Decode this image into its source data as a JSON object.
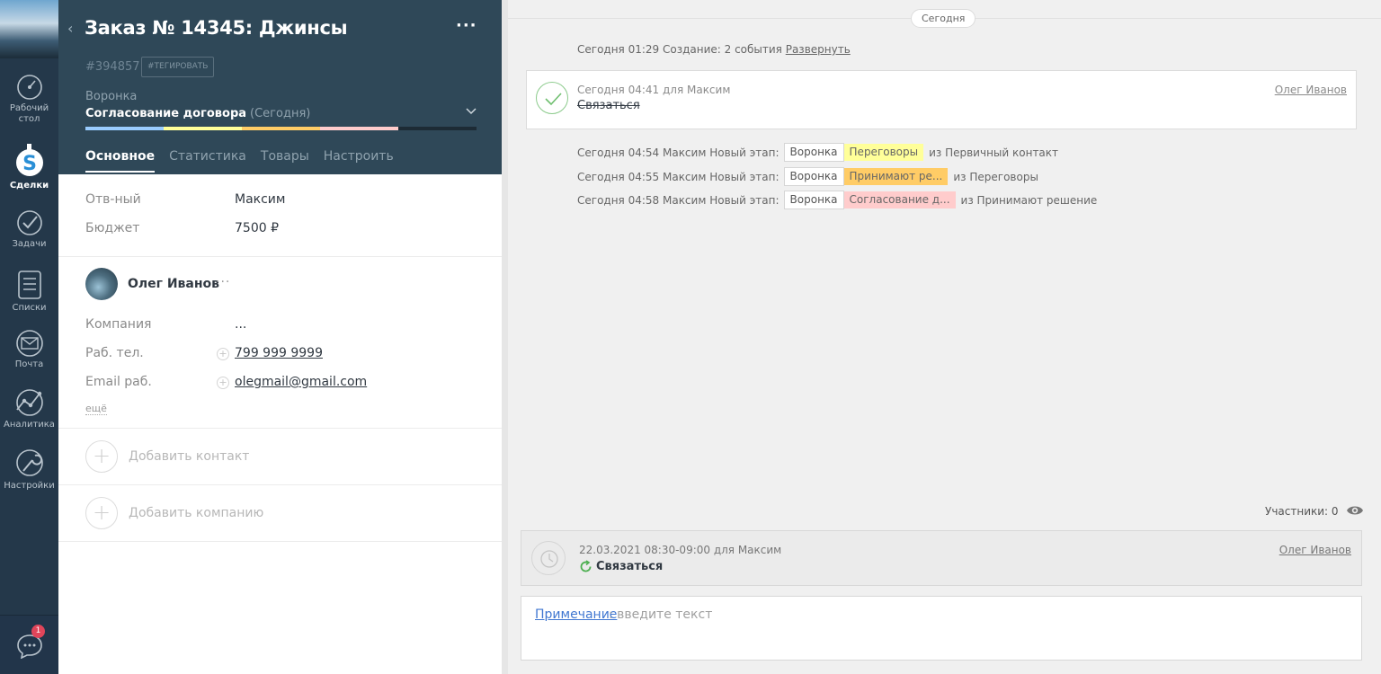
{
  "nav": {
    "items": [
      {
        "label1": "Рабочий",
        "label2": "стол"
      },
      {
        "label1": "Сделки",
        "label2": ""
      },
      {
        "label1": "Задачи",
        "label2": ""
      },
      {
        "label1": "Списки",
        "label2": ""
      },
      {
        "label1": "Почта",
        "label2": ""
      },
      {
        "label1": "Аналитика",
        "label2": ""
      },
      {
        "label1": "Настройки",
        "label2": ""
      }
    ],
    "chat_badge": "1"
  },
  "card": {
    "title": "Заказ № 14345: Джинсы",
    "more": "···",
    "deal_id": "#394857",
    "tag_button": "#ТЕГИРОВАТЬ",
    "funnel_label": "Воронка",
    "stage": "Согласование договора",
    "stage_date": "(Сегодня)",
    "progress_colors": [
      "#99ccff",
      "#ffff99",
      "#ffcc66",
      "#ffcccc"
    ],
    "tabs": [
      "Основное",
      "Статистика",
      "Товары",
      "Настроить"
    ],
    "fields": {
      "responsible_label": "Отв-ный",
      "responsible_value": "Максим",
      "budget_label": "Бюджет",
      "budget_value": "7500 ₽"
    },
    "contact": {
      "name": "Олег Иванов",
      "more": "···",
      "company_label": "Компания",
      "company_value": "...",
      "phone_label": "Раб. тел.",
      "phone_value": "799 999 9999",
      "email_label": "Email раб.",
      "email_value": "olegmail@gmail.com",
      "more_link": "ещё"
    },
    "add_contact": "Добавить контакт",
    "add_company": "Добавить компанию"
  },
  "feed": {
    "today_pill": "Сегодня",
    "creation": {
      "text": "Сегодня 01:29 Создание: 2 события",
      "expand": "Развернуть"
    },
    "task": {
      "meta": "Сегодня 04:41  для Максим",
      "name": "Связаться",
      "author": "Олег Иванов"
    },
    "stage_events": [
      {
        "pre": "Сегодня 04:54 Максим  Новый этап:",
        "funnel": "Воронка",
        "stage": "Переговоры",
        "stage_color": "#ffff99",
        "post": "из Первичный контакт"
      },
      {
        "pre": "Сегодня 04:55 Максим  Новый этап:",
        "funnel": "Воронка",
        "stage": "Принимают ре...",
        "stage_color": "#ffcc66",
        "post": "из Переговоры"
      },
      {
        "pre": "Сегодня 04:58 Максим  Новый этап:",
        "funnel": "Воронка",
        "stage": "Согласование д...",
        "stage_color": "#ffcccc",
        "post": "из Принимают решение"
      }
    ],
    "participants": "Участники: 0",
    "open_task": {
      "meta": "22.03.2021 08:30-09:00 для Максим",
      "name": "Связаться",
      "author": "Олег Иванов"
    },
    "note": {
      "label": "Примечание",
      "placeholder": ": введите текст"
    }
  }
}
